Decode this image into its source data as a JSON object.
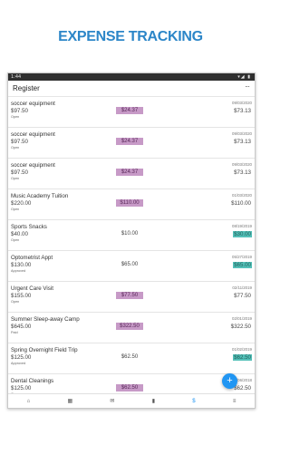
{
  "headline": "EXPENSE TRACKING",
  "status_bar": {
    "time": "1:44",
    "icons": "▾◢ ▮"
  },
  "app_bar": {
    "title": "Register",
    "more": "···"
  },
  "rows": [
    {
      "name": "soccer equipment",
      "total": "$97.50",
      "status": "Open",
      "payment": "$24.37",
      "payment_highlight": true,
      "date": "09/03/2020",
      "due": "$73.13",
      "due_highlight": false
    },
    {
      "name": "soccer equipment",
      "total": "$97.50",
      "status": "Open",
      "payment": "$24.37",
      "payment_highlight": true,
      "date": "09/03/2020",
      "due": "$73.13",
      "due_highlight": false
    },
    {
      "name": "soccer equipment",
      "total": "$97.50",
      "status": "Open",
      "payment": "$24.37",
      "payment_highlight": true,
      "date": "09/03/2020",
      "due": "$73.13",
      "due_highlight": false
    },
    {
      "name": "Music Academy Tuition",
      "total": "$220.00",
      "status": "Open",
      "payment": "$110.00",
      "payment_highlight": true,
      "date": "01/03/2020",
      "due": "$110.00",
      "due_highlight": false
    },
    {
      "name": "Sports Snacks",
      "total": "$40.00",
      "status": "Open",
      "payment": "$10.00",
      "payment_highlight": false,
      "date": "08/19/2019",
      "due": "$30.00",
      "due_highlight": true
    },
    {
      "name": "Optometrist Appt",
      "total": "$130.00",
      "status": "Approved",
      "payment": "$65.00",
      "payment_highlight": false,
      "date": "05/27/2019",
      "due": "$65.00",
      "due_highlight": true
    },
    {
      "name": "Urgent Care Visit",
      "total": "$155.00",
      "status": "Open",
      "payment": "$77.50",
      "payment_highlight": true,
      "date": "02/11/2019",
      "due": "$77.50",
      "due_highlight": false
    },
    {
      "name": "Summer Sleep-away Camp",
      "total": "$645.00",
      "status": "Paid",
      "payment": "$322.50",
      "payment_highlight": true,
      "date": "02/01/2019",
      "due": "$322.50",
      "due_highlight": false
    },
    {
      "name": "Spring Overnight Field Trip",
      "total": "$125.00",
      "status": "Approved",
      "payment": "$62.50",
      "payment_highlight": false,
      "date": "01/02/2019",
      "due": "$62.50",
      "due_highlight": true
    },
    {
      "name": "Dental Cleanings",
      "total": "$125.00",
      "status": "Open",
      "payment": "$62.50",
      "payment_highlight": true,
      "date": "11/06/2018",
      "due": "$62.50",
      "due_highlight": false
    }
  ],
  "fab": {
    "label": "+"
  },
  "bottom_nav": [
    {
      "icon": "home-icon",
      "glyph": "⌂"
    },
    {
      "icon": "calendar-icon",
      "glyph": "▦"
    },
    {
      "icon": "mail-icon",
      "glyph": "✉"
    },
    {
      "icon": "book-icon",
      "glyph": "▮"
    },
    {
      "icon": "dollar-icon",
      "glyph": "$",
      "active": true
    },
    {
      "icon": "menu-icon",
      "glyph": "≡"
    }
  ],
  "colors": {
    "headline": "#2c86c8",
    "payment_highlight": "#c79ac7",
    "due_highlight": "#54c0b8",
    "accent": "#2196f3"
  }
}
